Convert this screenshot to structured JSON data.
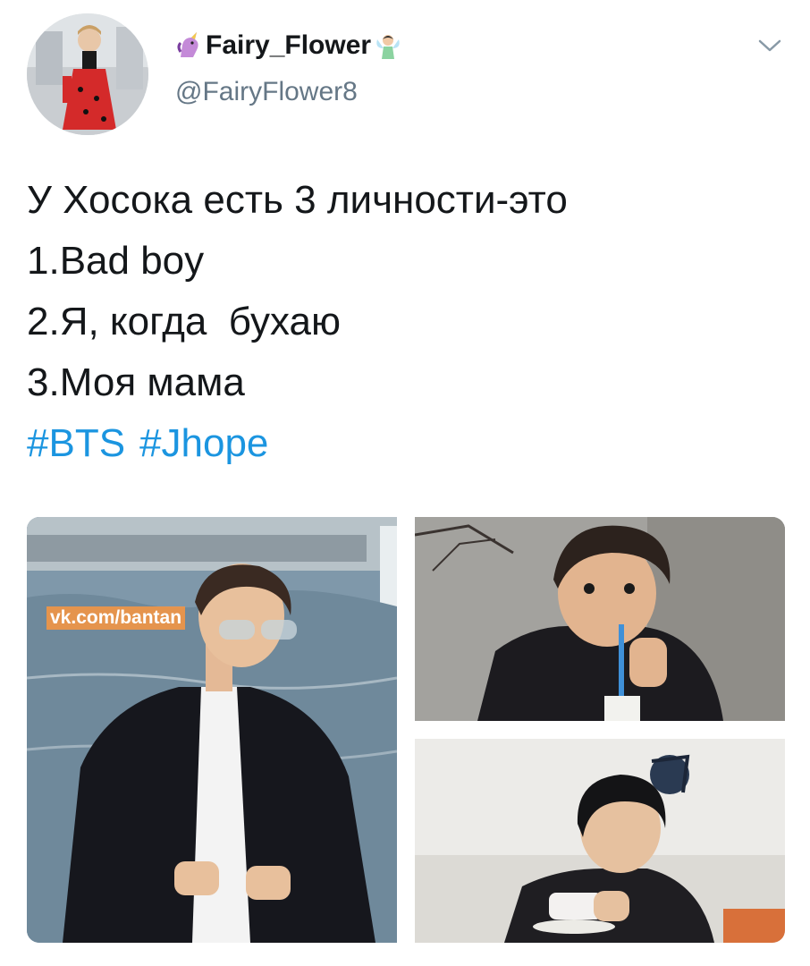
{
  "user": {
    "display_name": "Fairy_Flower",
    "handle": "@FairyFlower8"
  },
  "icons": {
    "unicorn": "unicorn-emoji",
    "fairy": "fairy-emoji",
    "menu": "chevron-down-icon"
  },
  "tweet": {
    "lines": [
      "У Хосока есть 3 личности-это",
      "1.Bad boy",
      "2.Я, когда  бухаю",
      "3.Моя мама"
    ],
    "hashtags": [
      "#BTS",
      "#Jhope"
    ]
  },
  "media": {
    "watermark": "vk.com/bantan"
  },
  "colors": {
    "text": "#14171a",
    "secondary": "#657786",
    "link": "#1b95e0",
    "background": "#ffffff"
  }
}
